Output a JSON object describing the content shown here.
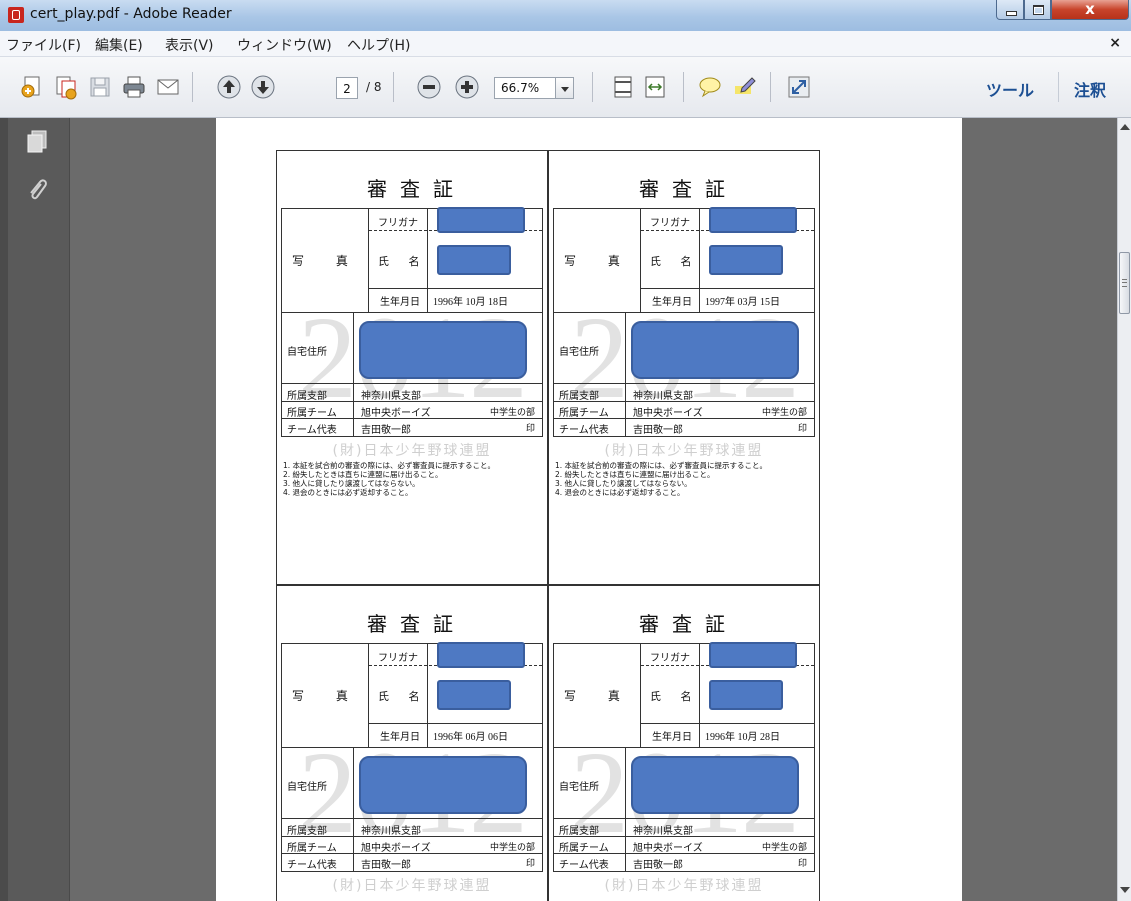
{
  "window": {
    "title": "cert_play.pdf - Adobe Reader"
  },
  "menu": {
    "items": [
      "ファイル(F)",
      "編集(E)",
      "表示(V)",
      "ウィンドウ(W)",
      "ヘルプ(H)"
    ],
    "close_glyph": "×"
  },
  "toolbar": {
    "current_page": "2",
    "page_total": "/ 8",
    "zoom": "66.7%",
    "tools_label": "ツール",
    "comment_label": "注釈"
  },
  "certificate_template": {
    "title": "審 査 証",
    "watermark": "2012",
    "furigana_label": "フリガナ",
    "photo_label": "写 真",
    "name_label": "氏 名",
    "birth_label": "生年月日",
    "address_label": "自宅住所",
    "branch_label": "所属支部",
    "team_label": "所属チーム",
    "rep_label": "チーム代表",
    "association": "(財)日本少年野球連盟",
    "notes": [
      "1. 本証を試合前の審査の際には、必ず審査員に提示すること。",
      "2. 紛失したときは直ちに連盟に届け出ること。",
      "3. 他人に貸したり譲渡してはならない。",
      "4. 退会のときには必ず返却すること。"
    ]
  },
  "certificates": [
    {
      "birth": "1996年 10月 18日",
      "branch": "神奈川県支部",
      "team": "旭中央ボーイズ",
      "grade": "中学生の部",
      "rep": "吉田敬一郎",
      "seal": "印"
    },
    {
      "birth": "1997年 03月 15日",
      "branch": "神奈川県支部",
      "team": "旭中央ボーイズ",
      "grade": "中学生の部",
      "rep": "吉田敬一郎",
      "seal": "印"
    },
    {
      "birth": "1996年 06月 06日",
      "branch": "神奈川県支部",
      "team": "旭中央ボーイズ",
      "grade": "中学生の部",
      "rep": "吉田敬一郎",
      "seal": "印"
    },
    {
      "birth": "1996年 10月 28日",
      "branch": "神奈川県支部",
      "team": "旭中央ボーイズ",
      "grade": "中学生の部",
      "rep": "吉田敬一郎",
      "seal": "印"
    }
  ],
  "icons": {
    "toolbar": [
      "create-pdf-icon",
      "combine-icon",
      "save-icon",
      "print-icon",
      "email-icon",
      "prev-page-icon",
      "next-page-icon",
      "zoom-out-icon",
      "zoom-in-icon",
      "fit-page-icon",
      "fit-width-icon",
      "comment-icon",
      "highlight-icon",
      "fullscreen-icon"
    ],
    "nav": [
      "pages-icon",
      "attachments-icon"
    ]
  },
  "colors": {
    "redaction": "#4e79c3",
    "accent": "#1c4f93"
  }
}
